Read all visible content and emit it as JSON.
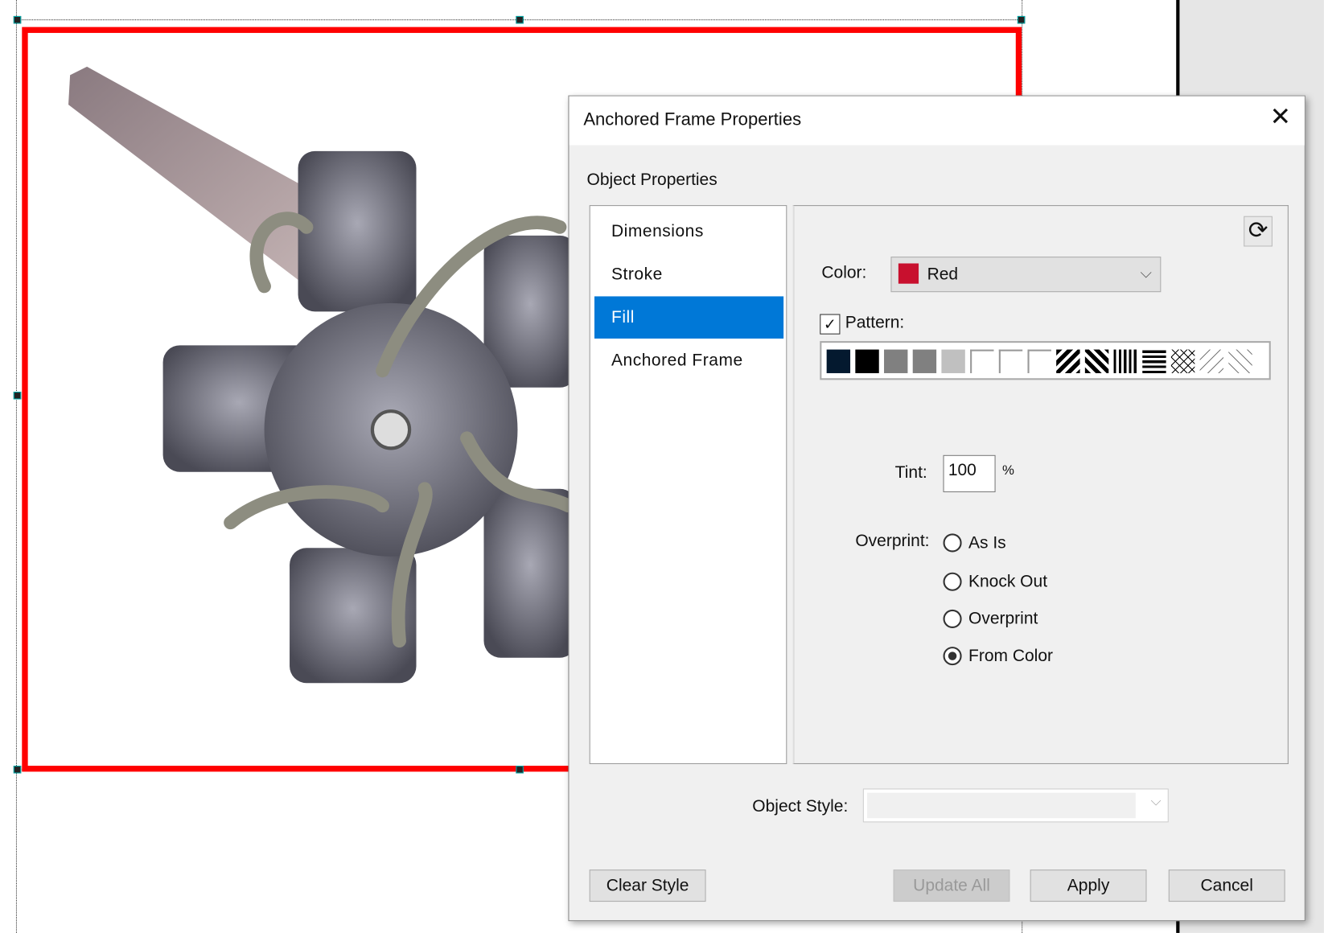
{
  "dialog": {
    "title": "Anchored Frame Properties",
    "section_label": "Object Properties",
    "categories": [
      {
        "label": "Dimensions",
        "selected": false
      },
      {
        "label": "Stroke",
        "selected": false
      },
      {
        "label": "Fill",
        "selected": true
      },
      {
        "label": "Anchored Frame",
        "selected": false
      }
    ],
    "fill": {
      "color_label": "Color:",
      "color_value": "Red",
      "color_swatch": "#c8102e",
      "pattern_label": "Pattern:",
      "pattern_checked": true,
      "tint_label": "Tint:",
      "tint_value": "100",
      "tint_unit": "%",
      "overprint_label": "Overprint:",
      "overprint_options": [
        {
          "label": "As Is",
          "checked": false
        },
        {
          "label": "Knock Out",
          "checked": false
        },
        {
          "label": "Overprint",
          "checked": false
        },
        {
          "label": "From Color",
          "checked": true
        }
      ]
    },
    "object_style_label": "Object Style:",
    "object_style_value": "",
    "buttons": {
      "clear_style": "Clear Style",
      "update_all": "Update All",
      "apply": "Apply",
      "cancel": "Cancel"
    }
  },
  "colors": {
    "frame_border": "#ff0000",
    "selection": "#0078d7"
  }
}
